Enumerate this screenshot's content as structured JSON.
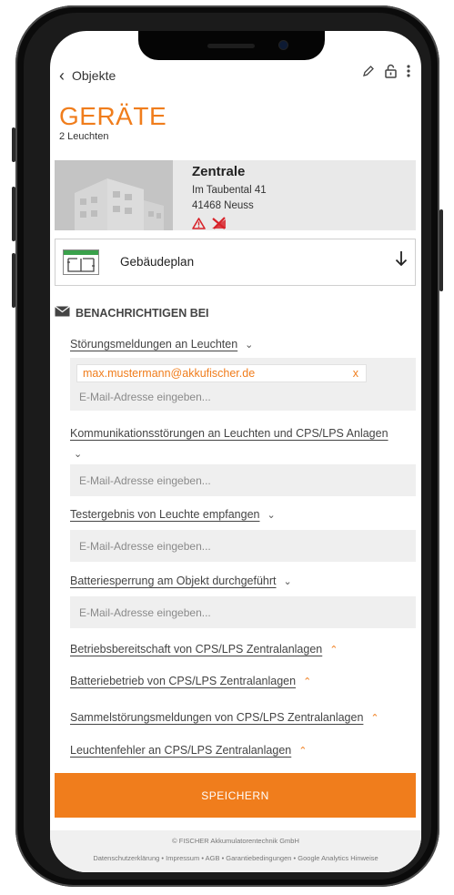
{
  "header": {
    "back_label": "Objekte",
    "title": "GERÄTE",
    "subtitle": "2 Leuchten"
  },
  "object": {
    "name": "Zentrale",
    "street": "Im Taubental 41",
    "city": "41468 Neuss",
    "icons": [
      "warning-icon",
      "no-connection-icon"
    ]
  },
  "floorplan": {
    "label": "Gebäudeplan"
  },
  "notify": {
    "heading": "BENACHRICHTIGEN BEI",
    "placeholder": "E-Mail-Adresse eingeben...",
    "sections": [
      {
        "label": "Störungsmeldungen an Leuchten",
        "expanded": true,
        "emails": [
          "max.mustermann@akkufischer.de"
        ]
      },
      {
        "label": "Kommunikationsstörungen an Leuchten und CPS/LPS Anlagen",
        "expanded": true,
        "emails": []
      },
      {
        "label": "Testergebnis von Leuchte empfangen",
        "expanded": true,
        "emails": []
      },
      {
        "label": "Batteriesperrung am Objekt durchgeführt",
        "expanded": true,
        "emails": []
      },
      {
        "label": "Betriebsbereitschaft von CPS/LPS Zentralanlagen",
        "expanded": false
      },
      {
        "label": "Batteriebetrieb von CPS/LPS Zentralanlagen",
        "expanded": false
      },
      {
        "label": "Sammelstörungsmeldungen von CPS/LPS Zentralanlagen",
        "expanded": false
      },
      {
        "label": "Leuchtenfehler an CPS/LPS Zentralanlagen",
        "expanded": false
      }
    ],
    "remove_label": "x"
  },
  "save_label": "SPEICHERN",
  "footer": {
    "copyright": "© FISCHER Akkumulatorentechnik GmbH",
    "links": [
      "Datenschutzerklärung",
      "Impressum",
      "AGB",
      "Garantiebedingungen",
      "Google Analytics Hinweise"
    ],
    "separator": "•"
  },
  "colors": {
    "accent": "#f07d1c",
    "warning": "#d8232a"
  }
}
